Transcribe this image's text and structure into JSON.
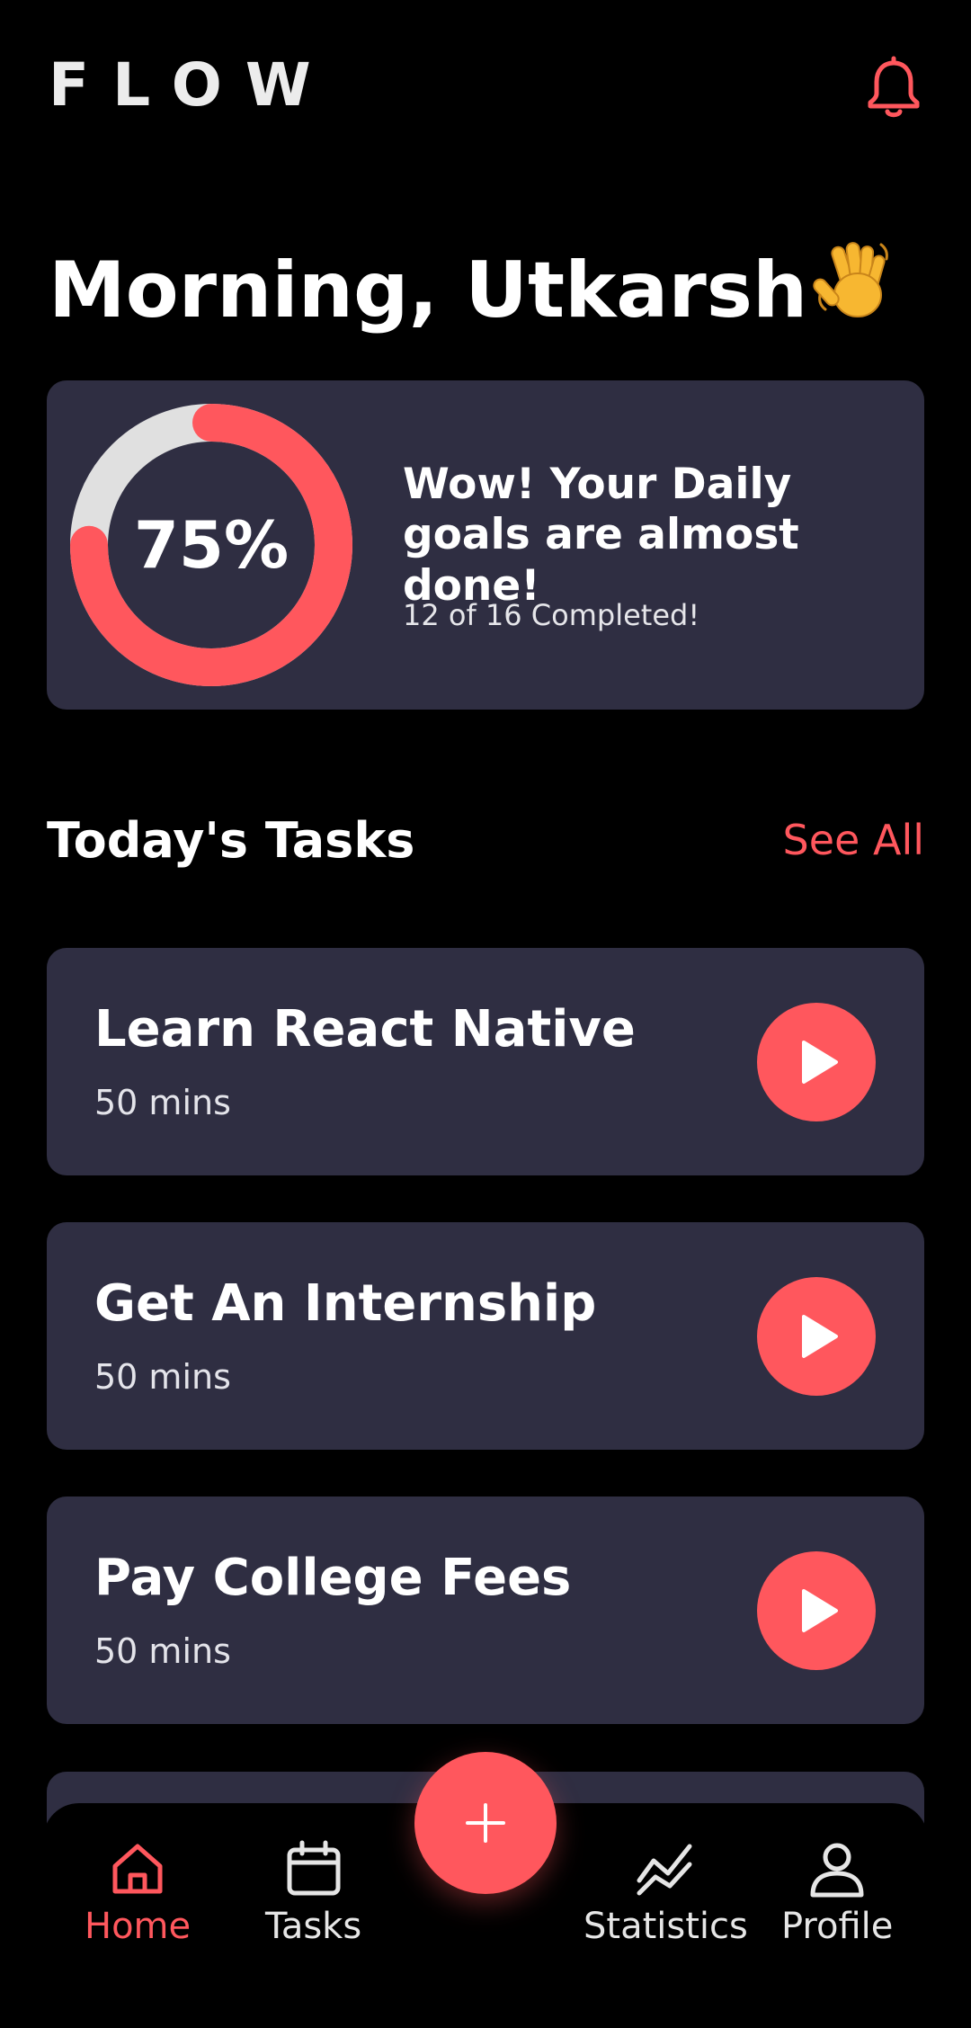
{
  "app": {
    "logo": "FLOW"
  },
  "header": {
    "notification_icon": "bell-icon"
  },
  "greeting": {
    "text": "Morning, Utkarsh",
    "emoji_icon": "waving-hand-icon"
  },
  "daily_goal": {
    "percent_label": "75%",
    "progress_fraction": 0.75,
    "title": "Wow! Your Daily goals are almost done!",
    "subtitle": "12 of 16 Completed!"
  },
  "tasks_section": {
    "title": "Today's Tasks",
    "see_all_label": "See All"
  },
  "tasks": [
    {
      "title": "Learn React Native",
      "duration": "50 mins",
      "action_icon": "play-icon"
    },
    {
      "title": "Get An Internship",
      "duration": "50 mins",
      "action_icon": "play-icon"
    },
    {
      "title": "Pay College Fees",
      "duration": "50 mins",
      "action_icon": "play-icon"
    }
  ],
  "bottom_nav": {
    "items": [
      {
        "label": "Home",
        "icon": "home-icon",
        "active": true
      },
      {
        "label": "Tasks",
        "icon": "calendar-icon",
        "active": false
      },
      {
        "label": "Statistics",
        "icon": "chart-line-icon",
        "active": false
      },
      {
        "label": "Profile",
        "icon": "user-icon",
        "active": false
      }
    ],
    "fab_icon": "plus-icon"
  },
  "colors": {
    "background": "#000000",
    "card": "#2f2e42",
    "accent": "#ff575d",
    "ring_track": "#e0e0e0"
  }
}
